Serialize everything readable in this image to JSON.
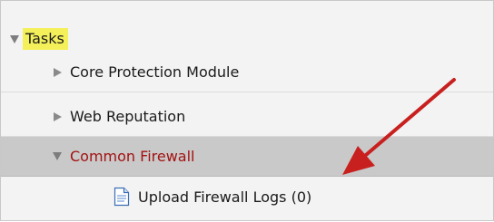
{
  "tree": {
    "root": {
      "label": "Tasks",
      "expanded": true,
      "highlight_color": "#f4f05a"
    },
    "items": [
      {
        "label": "Core Protection Module",
        "expanded": false
      },
      {
        "label": "Web Reputation",
        "expanded": false
      },
      {
        "label": "Common Firewall",
        "expanded": true,
        "selected": true,
        "text_color": "#a31212",
        "children": [
          {
            "label": "Upload Firewall Logs (0)",
            "icon": "document-icon"
          }
        ]
      }
    ]
  },
  "annotation": {
    "type": "arrow",
    "color": "#c8201e",
    "points_to": "Upload Firewall Logs (0)"
  }
}
